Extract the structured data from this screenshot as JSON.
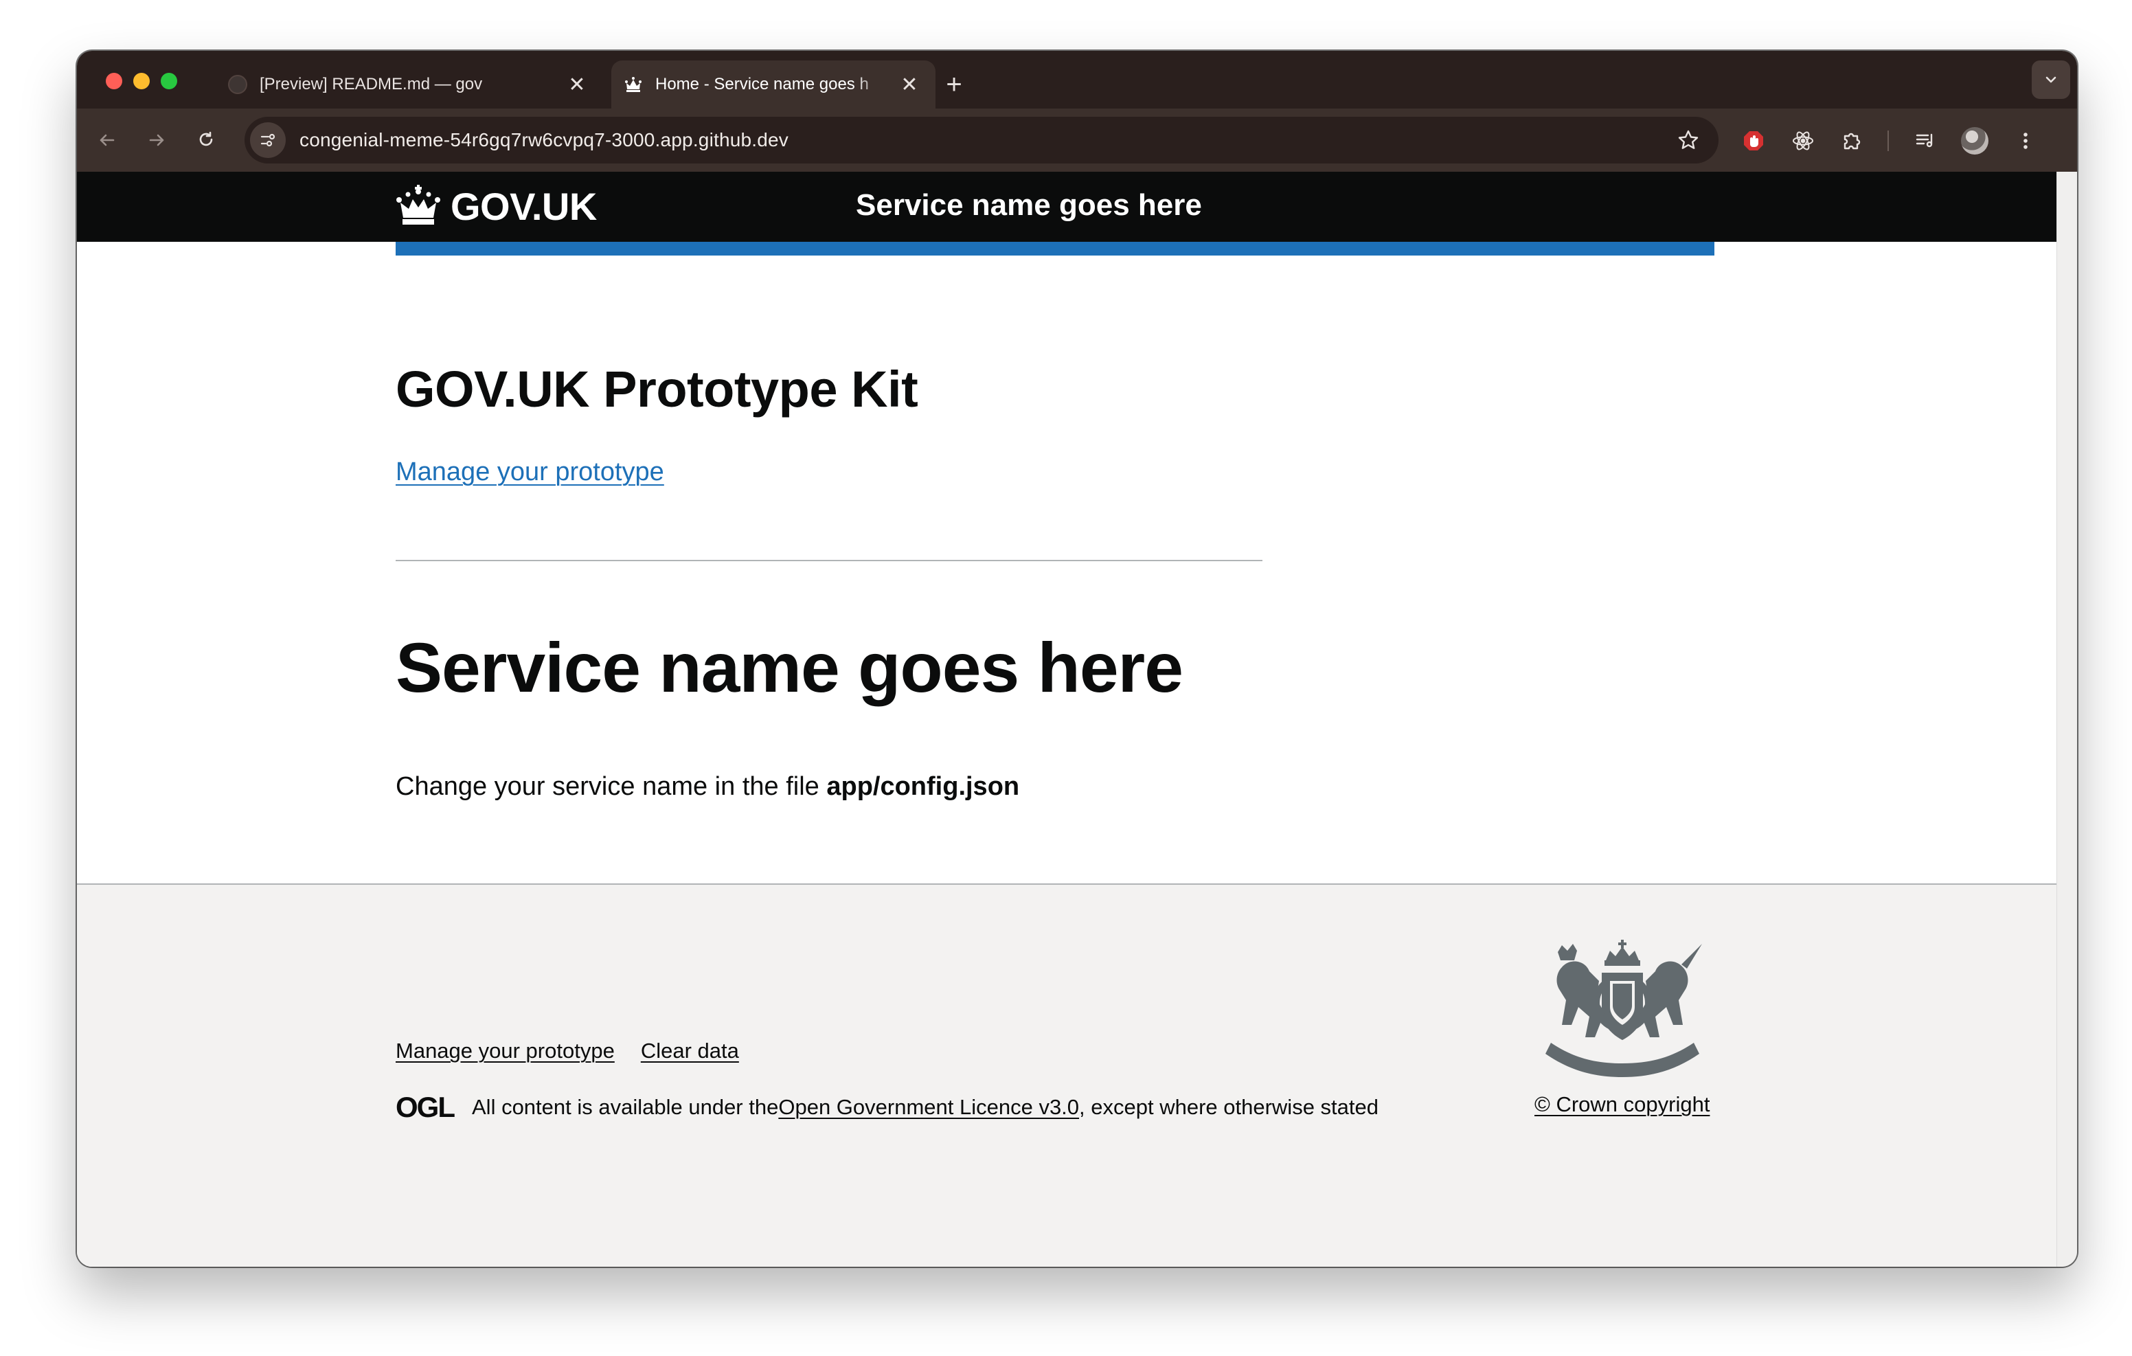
{
  "browser": {
    "tabs": [
      {
        "title": "[Preview] README.md — gov",
        "active": false,
        "favicon": "github-icon"
      },
      {
        "title": "Home - Service name goes h",
        "active": true,
        "favicon": "govuk-crown-icon"
      }
    ],
    "close_glyph": "✕",
    "new_tab_glyph": "+",
    "address_bar": {
      "url": "congenial-meme-54r6gq7rw6cvpq7-3000.app.github.dev"
    }
  },
  "page": {
    "header": {
      "logo_text": "GOV.UK",
      "service_name": "Service name goes here"
    },
    "main": {
      "kit_title": "GOV.UK Prototype Kit",
      "manage_link": "Manage your prototype",
      "service_heading": "Service name goes here",
      "config_text": "Change your service name in the file ",
      "config_file": "app/config.json"
    },
    "footer": {
      "links": [
        "Manage your prototype",
        "Clear data"
      ],
      "ogl_logo": "OGL",
      "licence_prefix": "All content is available under the ",
      "licence_link": "Open Government Licence v3.0",
      "licence_suffix": ", except where otherwise stated",
      "crown_copyright": "© Crown copyright"
    }
  },
  "colors": {
    "govuk_black": "#0b0c0c",
    "govuk_blue": "#1d70b8",
    "footer_bg": "#f3f2f1",
    "border_grey": "#b1b4b6",
    "browser_frame": "#2a1f1d",
    "browser_toolbar": "#3c302c"
  }
}
